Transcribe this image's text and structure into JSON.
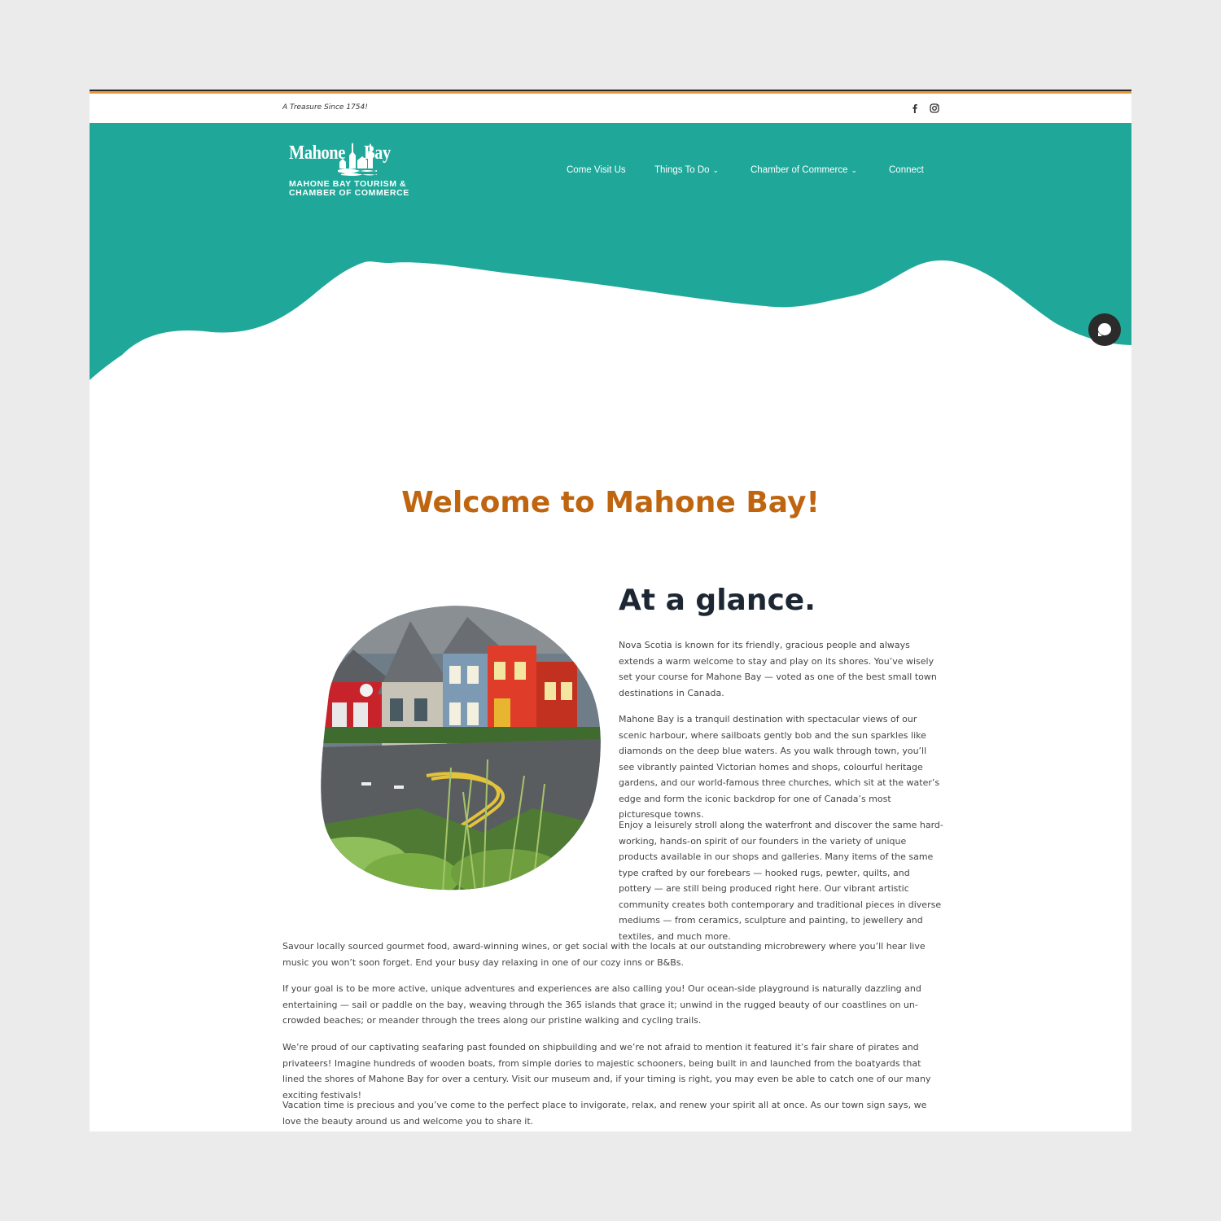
{
  "topbar": {
    "tagline": "A Treasure Since 1754!",
    "social": [
      {
        "name": "facebook-icon"
      },
      {
        "name": "instagram-icon"
      }
    ]
  },
  "logo": {
    "line1_left": "Mahone",
    "line1_right": "Bay",
    "line2": "MAHONE BAY TOURISM &",
    "line3": "CHAMBER OF COMMERCE"
  },
  "nav": {
    "items": [
      {
        "label": "Come Visit Us",
        "has_dropdown": false
      },
      {
        "label": "Things To Do",
        "has_dropdown": true
      },
      {
        "label": "Chamber of Commerce",
        "has_dropdown": true
      },
      {
        "label": "Connect",
        "has_dropdown": false
      }
    ]
  },
  "main": {
    "welcome_title": "Welcome to Mahone Bay!",
    "glance_title": "At a glance.",
    "paragraphs": [
      "Nova Scotia is known for its friendly, gracious people and always extends a warm welcome to stay and play on its shores. You’ve wisely set your course for Mahone Bay — voted as one of the best small town destinations in Canada.",
      "Mahone Bay is a tranquil destination with spectacular views of our scenic harbour, where sailboats gently bob and the sun sparkles like diamonds on the deep blue waters. As you walk through town, you’ll see vibrantly painted Victorian homes and shops, colourful heritage gardens, and our world-famous three churches, which sit at the water’s edge and form the iconic backdrop for one of Canada’s most picturesque towns.",
      "Enjoy a leisurely stroll along the waterfront and discover the same hard-working, hands-on spirit of our founders in the variety of unique products available in our shops and galleries. Many items of the same type crafted by our forebears — hooked rugs, pewter, quilts, and pottery — are still being produced right here. Our vibrant artistic community creates both contemporary and traditional pieces in diverse mediums — from ceramics, sculpture and painting, to jewellery and textiles, and much more.",
      "Savour locally sourced gourmet food, award-winning wines, or get social with the locals at our outstanding microbrewery where you’ll hear live music you won’t soon forget. End your busy day relaxing in one of our cozy inns or B&Bs.",
      "If your goal is to be more active, unique adventures and experiences are also calling you! Our ocean-side playground is naturally dazzling and entertaining — sail or paddle on the bay, weaving through the 365 islands that grace it; unwind in the rugged beauty of our coastlines on un-crowded beaches; or meander through the trees along our pristine walking and cycling trails.",
      "We’re proud of our captivating seafaring past founded on shipbuilding and we’re not afraid to mention it featured it’s fair share of pirates and privateers! Imagine hundreds of wooden boats, from simple dories to majestic schooners, being built in and launched from the boatyards that lined the shores of Mahone Bay for over a century. Visit our museum and, if your timing is right, you may even be able to catch one of our many exciting festivals!",
      "Vacation time is precious and you’ve come to the perfect place to invigorate, relax, and renew your spirit all at once. As our town sign says, we love the beauty around us and welcome you to share it."
    ]
  },
  "colors": {
    "teal": "#1fa89a",
    "orange_title": "#c0650f",
    "orange_stripe": "#e8973a",
    "dark_heading": "#1d2733"
  },
  "chat": {
    "icon": "chat-bubble-icon"
  }
}
